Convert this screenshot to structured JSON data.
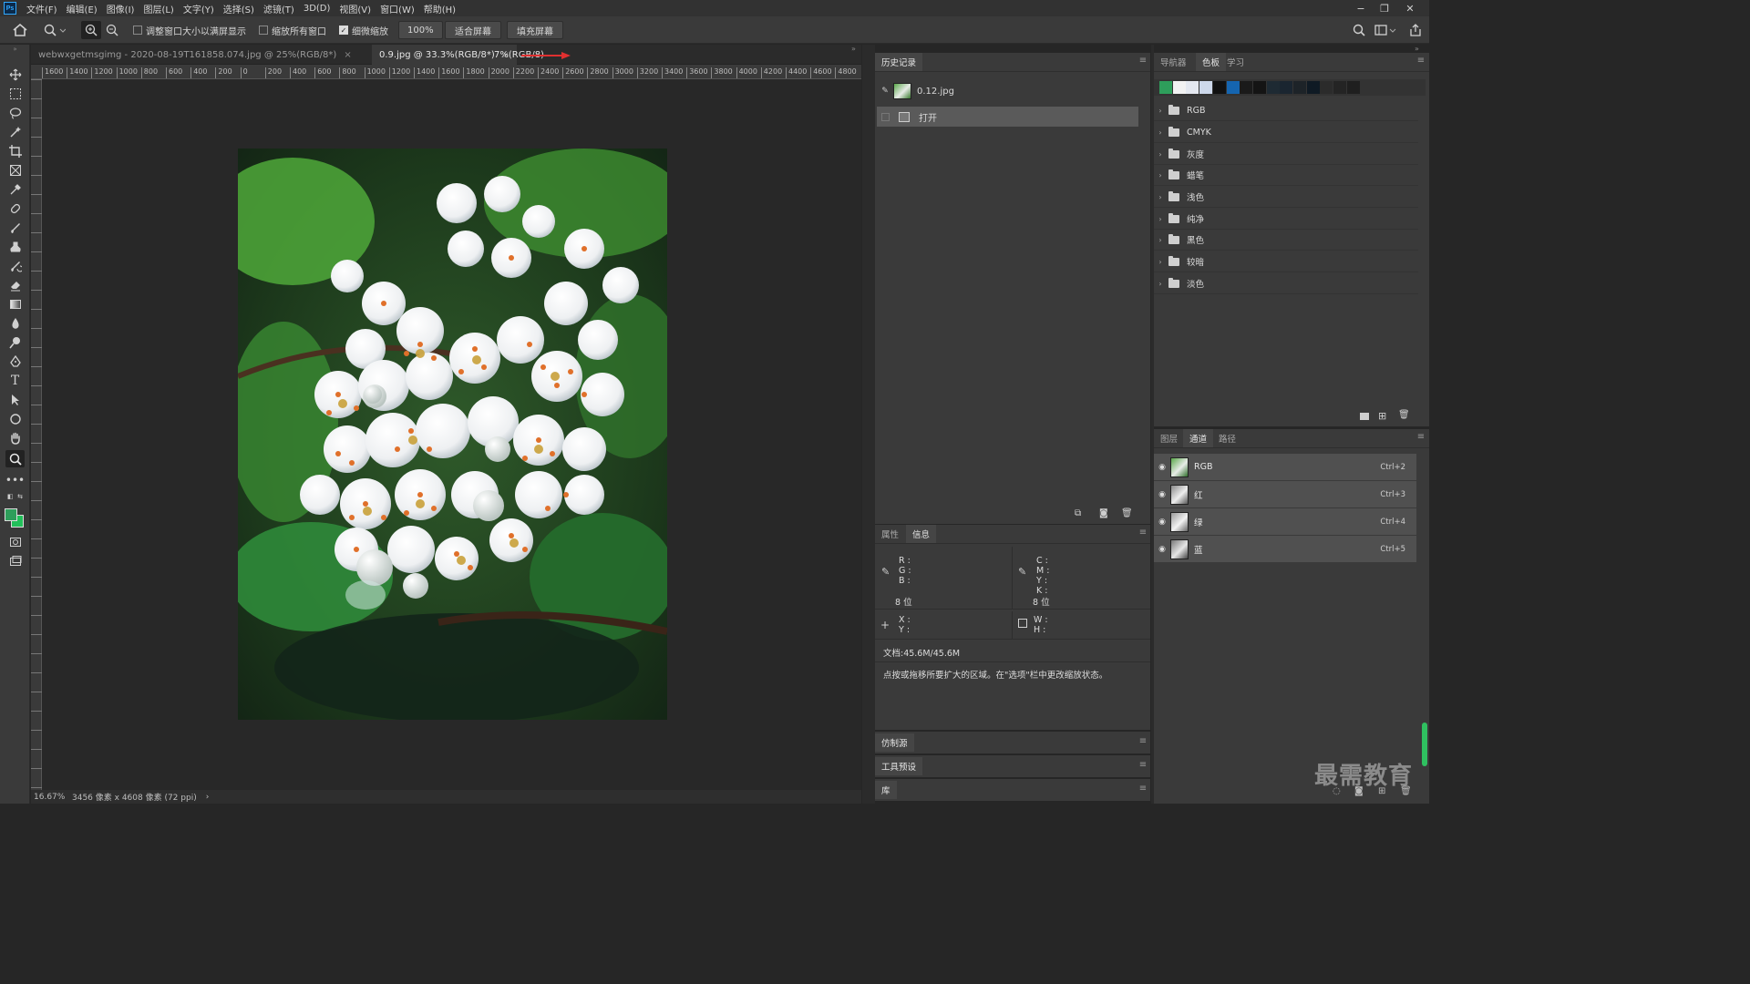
{
  "app": {
    "logo": "Ps",
    "menu": [
      "文件(F)",
      "编辑(E)",
      "图像(I)",
      "图层(L)",
      "文字(Y)",
      "选择(S)",
      "滤镜(T)",
      "3D(D)",
      "视图(V)",
      "窗口(W)",
      "帮助(H)"
    ]
  },
  "options": {
    "resize_windows": "调整窗口大小以满屏显示",
    "zoom_all": "缩放所有窗口",
    "scrubby_zoom": "细微缩放",
    "zoom_value": "100%",
    "fit_screen": "适合屏幕",
    "fill_screen": "填充屏幕"
  },
  "tabs": {
    "tab1": "webwxgetmsgimg - 2020-08-19T161858.074.jpg @ 25%(RGB/8*)",
    "tab2": "0.9.jpg @ 33.3%(RGB/8*)",
    "tab3": "7%(RGB/8)",
    "close": "×"
  },
  "ruler": {
    "h_labels": [
      "1600",
      "1400",
      "1200",
      "1000",
      "800",
      "600",
      "400",
      "200",
      "0",
      "200",
      "400",
      "600",
      "800",
      "1000",
      "1200",
      "1400",
      "1600",
      "1800",
      "2000",
      "2200",
      "2400",
      "2600",
      "2800",
      "3000",
      "3200",
      "3400",
      "3600",
      "3800",
      "4000",
      "4200",
      "4400",
      "4600",
      "4800"
    ]
  },
  "status": {
    "zoom": "16.67%",
    "doc_info": "3456 像素 x 4608 像素 (72 ppi)",
    "arrow": "›"
  },
  "history": {
    "tab": "历史记录",
    "snapshot": "0.12.jpg",
    "step": "打开"
  },
  "info_panel": {
    "tabs": [
      "属性",
      "信息"
    ],
    "rgb": [
      "R :",
      "G :",
      "B :"
    ],
    "cmyk": [
      "C :",
      "M :",
      "Y :",
      "K :"
    ],
    "bits_left": "8 位",
    "bits_right": "8 位",
    "xy": [
      "X :",
      "Y :"
    ],
    "wh": [
      "W :",
      "H :"
    ],
    "doc": "文档:45.6M/45.6M",
    "hint": "点按或拖移所要扩大的区域。在\"选项\"栏中更改缩放状态。"
  },
  "collapsed_panels": [
    "仿制源",
    "工具预设",
    "库"
  ],
  "swatches_panel": {
    "tabs": [
      "导航器",
      "色板",
      "学习"
    ],
    "colors": [
      "#2e9e5b",
      "#f2f2f2",
      "#e4e8f0",
      "#cdd8ea",
      "#111111",
      "#1565b0",
      "#1a1a1a",
      "#141414",
      "#1e2a33",
      "#1a2530",
      "#1d2328",
      "#0f1a24",
      "#2b2b2b",
      "#242424",
      "#1f1f1f"
    ],
    "groups": [
      "RGB",
      "CMYK",
      "灰度",
      "蜡笔",
      "浅色",
      "纯净",
      "黑色",
      "较暗",
      "淡色"
    ]
  },
  "channels_panel": {
    "tabs": [
      "图层",
      "通道",
      "路径"
    ],
    "channels": [
      {
        "name": "RGB",
        "shortcut": "Ctrl+2"
      },
      {
        "name": "红",
        "shortcut": "Ctrl+3"
      },
      {
        "name": "绿",
        "shortcut": "Ctrl+4"
      },
      {
        "name": "蓝",
        "shortcut": "Ctrl+5"
      }
    ]
  },
  "watermark": "最需教育",
  "colors": {
    "fg": "#2e9e5b",
    "bg": "#22c05a",
    "accent_arrow": "#e03030"
  }
}
